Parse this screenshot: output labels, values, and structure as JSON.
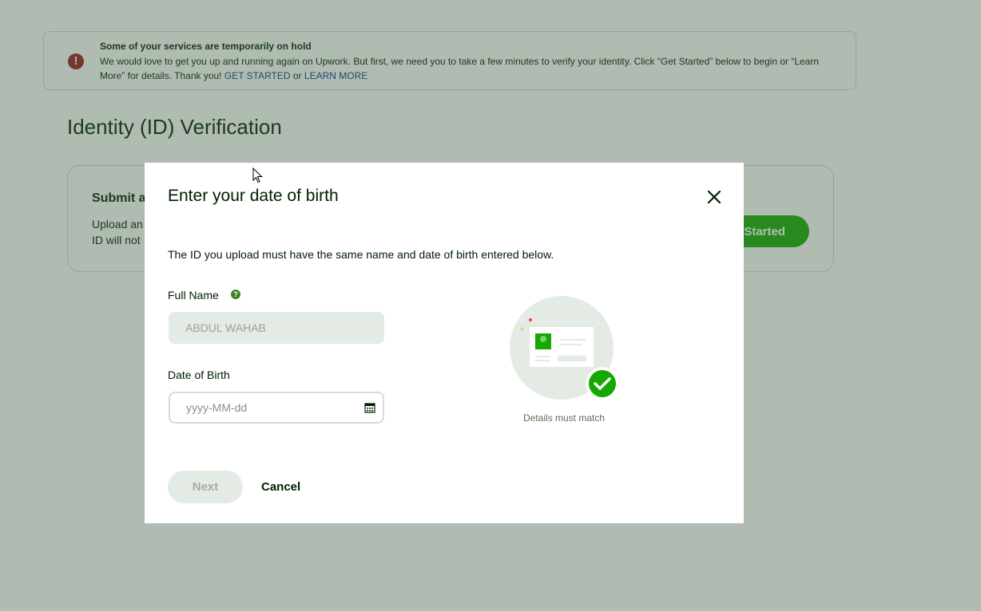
{
  "alert": {
    "title": "Some of your services are temporarily on hold",
    "body": "We would love to get you up and running again on Upwork. But first, we need you to take a few minutes to verify your identity. Click “Get Started” below to begin or “Learn More” for details. Thank you!",
    "get_started_link": "GET STARTED",
    "or_text": "or",
    "learn_more_link": "LEARN MORE",
    "icon": "exclamation-icon",
    "icon_glyph": "!"
  },
  "page": {
    "title": "Identity (ID) Verification"
  },
  "card": {
    "title": "Submit a",
    "text_line1": "Upload an",
    "text_line2": "ID will not",
    "button_label": "Started"
  },
  "modal": {
    "title": "Enter your date of birth",
    "intro": "The ID you upload must have the same name and date of birth entered below.",
    "full_name_label": "Full Name",
    "full_name_value": "ABDUL WAHAB",
    "help_glyph": "?",
    "dob_label": "Date of Birth",
    "dob_placeholder": "yyyy-MM-dd",
    "dob_value": "",
    "illustration_caption": "Details must match",
    "next_label": "Next",
    "cancel_label": "Cancel",
    "icons": [
      "close-icon",
      "help-icon",
      "calendar-icon",
      "id-card-illustration",
      "checkmark-icon"
    ]
  },
  "colors": {
    "brand_green": "#14a800",
    "overlay_tint": "#426048",
    "alert_red": "#9b1b1b",
    "link_blue": "#0b3a8c",
    "text_dark": "#001e00"
  }
}
